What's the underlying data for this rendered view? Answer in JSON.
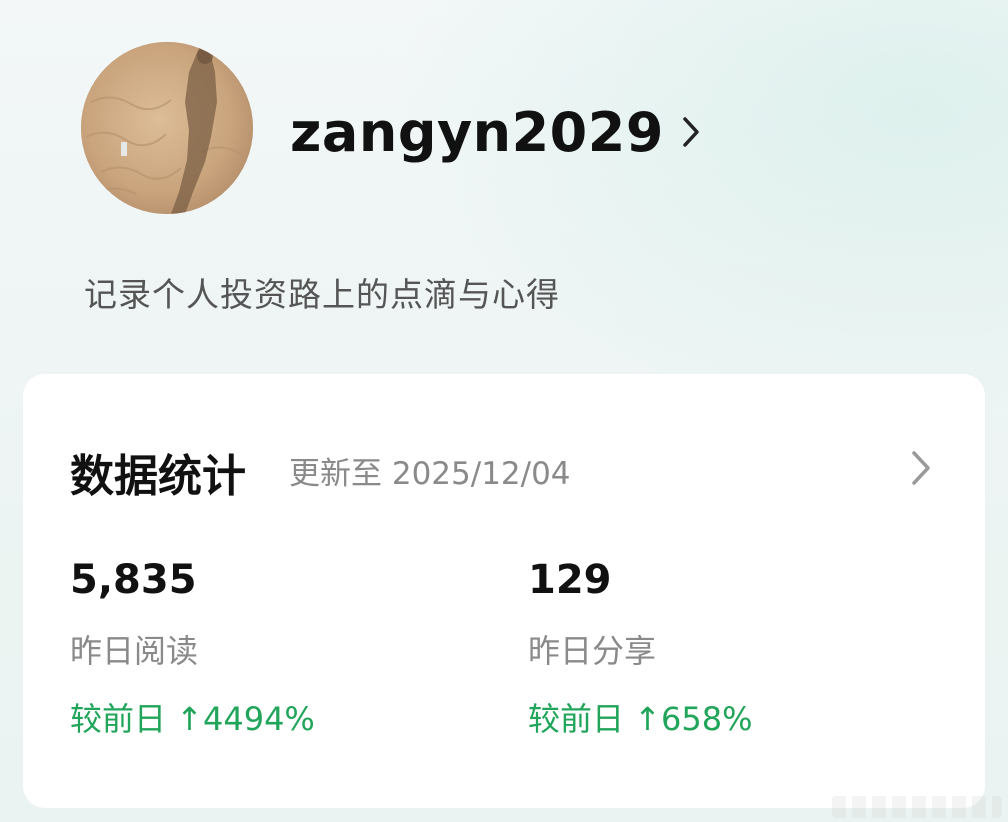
{
  "profile": {
    "username": "zangyn2029",
    "bio": "记录个人投资路上的点滴与心得"
  },
  "stats_card": {
    "title": "数据统计",
    "updated": "更新至 2025/12/04",
    "items": [
      {
        "value": "5,835",
        "label": "昨日阅读",
        "change": "较前日 ↑4494%"
      },
      {
        "value": "129",
        "label": "昨日分享",
        "change": "较前日 ↑658%"
      }
    ]
  },
  "colors": {
    "positive_change": "#21a55a",
    "card_background": "#ffffff",
    "page_background": "#eef5f4"
  },
  "icons": {
    "profile_chevron": "chevron-right-icon",
    "card_chevron": "chevron-right-icon"
  }
}
